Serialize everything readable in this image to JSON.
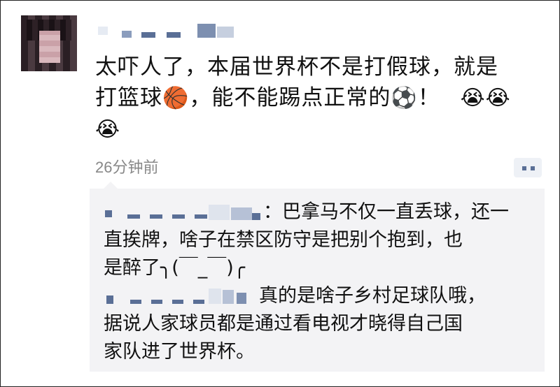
{
  "post": {
    "text_line1": "太吓人了，本届世界杯不是打假球，就是",
    "text_line2a": "打篮球",
    "basketball_emoji": "🏀",
    "text_line2b": "，能不能踢点正常的",
    "soccer_emoji": "⚽",
    "text_line2c": "！",
    "laugh_emoji": "😭",
    "time": "26分钟前"
  },
  "comments": [
    {
      "text_a": "：巴拿马不仅一直丢球，还一",
      "text_b": "直挨牌，啥子在禁区防守是把别个抱到，也",
      "text_c": "是醉了╮(￣_￣)╭"
    },
    {
      "text_a": "真的是啥子乡村足球队哦，",
      "text_b": "据说人家球员都是通过看电视才晓得自己国",
      "text_c": "家队进了世界杯。"
    }
  ],
  "colors": {
    "link_blue": "#5a6f96",
    "time_gray": "#888888",
    "comment_bg": "#f3f3f5"
  }
}
